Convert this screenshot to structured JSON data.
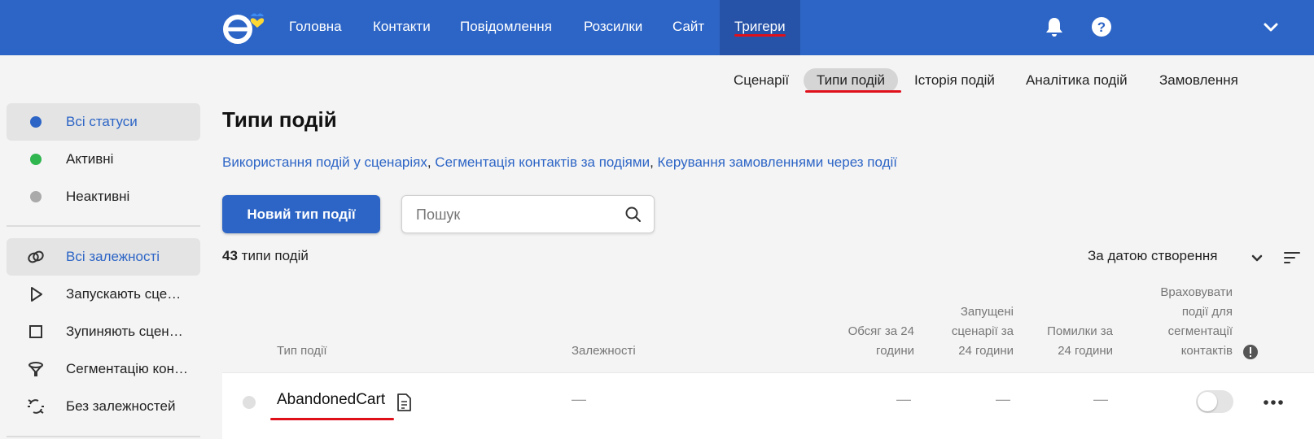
{
  "colors": {
    "brand": "#2d65c6",
    "accent_red": "#e0101b",
    "status_all": "#2d65c6",
    "status_active": "#2fb64f",
    "status_inactive": "#aaaaaa"
  },
  "nav": {
    "items": [
      {
        "label": "Головна"
      },
      {
        "label": "Контакти"
      },
      {
        "label": "Повідомлення"
      },
      {
        "label": "Розсилки"
      },
      {
        "label": "Сайт"
      },
      {
        "label": "Тригери",
        "active": true
      }
    ],
    "icons": [
      "bell-icon",
      "help-icon",
      "chevron-down-icon"
    ]
  },
  "subnav": {
    "items": [
      {
        "label": "Сценарії"
      },
      {
        "label": "Типи подій",
        "active": true
      },
      {
        "label": "Історія подій"
      },
      {
        "label": "Аналітика подій"
      },
      {
        "label": "Замовлення"
      }
    ]
  },
  "sidebar": {
    "statuses": [
      {
        "label": "Всі статуси",
        "active": true
      },
      {
        "label": "Активні"
      },
      {
        "label": "Неактивні"
      }
    ],
    "dependencies": [
      {
        "label": "Всі залежності",
        "icon": "link-icon",
        "active": true
      },
      {
        "label": "Запускають сценарії",
        "icon": "play-icon"
      },
      {
        "label": "Зупиняють сценарії",
        "icon": "stop-icon"
      },
      {
        "label": "Сегментацію контактів",
        "icon": "filter-icon"
      },
      {
        "label": "Без залежностей",
        "icon": "broken-link-icon"
      }
    ]
  },
  "main": {
    "title": "Типи подій",
    "links": [
      "Використання подій у сценаріях",
      "Сегментація контактів за подіями",
      "Керування замовленнями через події"
    ],
    "new_button": "Новий тип події",
    "search_placeholder": "Пошук",
    "count_number": "43",
    "count_label": "типи подій",
    "sort_label": "За датою створення"
  },
  "table": {
    "headers": {
      "type": "Тип події",
      "dependencies": "Залежності",
      "volume": [
        "Обсяг за 24",
        "години"
      ],
      "launched": [
        "Запущені",
        "сценарії за",
        "24 години"
      ],
      "errors": [
        "Помилки за",
        "24 години"
      ],
      "segmentation": [
        "Враховувати",
        "події для",
        "сегментації",
        "контактів"
      ]
    },
    "rows": [
      {
        "name": "AbandonedCart",
        "dependencies": "—",
        "volume": "—",
        "launched": "—",
        "errors": "—",
        "segmentation_enabled": false
      }
    ]
  }
}
